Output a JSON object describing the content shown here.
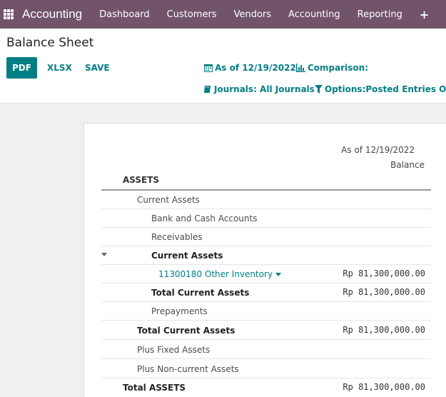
{
  "navbar": {
    "app_name": "Accounting",
    "menu": [
      "Dashboard",
      "Customers",
      "Vendors",
      "Accounting",
      "Reporting"
    ],
    "plus": "+"
  },
  "control": {
    "title": "Balance Sheet",
    "pdf": "PDF",
    "xlsx": "XLSX",
    "save": "SAVE",
    "date_filter": "As of 12/19/2022",
    "comparison": "Comparison:",
    "journals": "Journals: All Journals",
    "options": "Options:Posted Entries Only"
  },
  "report": {
    "date_header": "As of 12/19/2022",
    "column": "Balance",
    "section": "ASSETS",
    "rows": [
      {
        "label": "Current Assets",
        "amount": ""
      },
      {
        "label": "Bank and Cash Accounts",
        "amount": ""
      },
      {
        "label": "Receivables",
        "amount": ""
      },
      {
        "label": "Current Assets",
        "amount": ""
      },
      {
        "label": "11300180 Other Inventory",
        "amount": "Rp 81,300,000.00"
      },
      {
        "label": "Total Current Assets",
        "amount": "Rp 81,300,000.00"
      },
      {
        "label": "Prepayments",
        "amount": ""
      },
      {
        "label": "Total Current Assets",
        "amount": "Rp 81,300,000.00"
      },
      {
        "label": "Plus Fixed Assets",
        "amount": ""
      },
      {
        "label": "Plus Non-current Assets",
        "amount": ""
      },
      {
        "label": "Total ASSETS",
        "amount": "Rp 81,300,000.00"
      }
    ]
  }
}
